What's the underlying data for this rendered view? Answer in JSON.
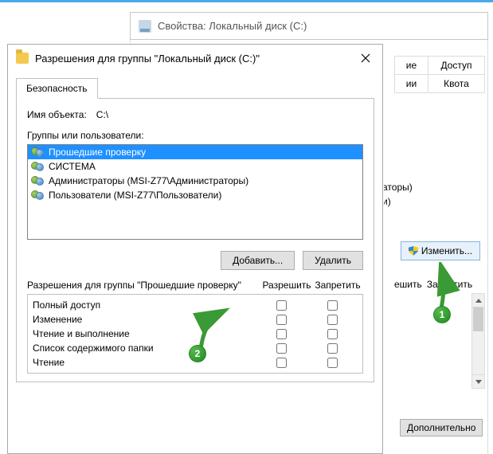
{
  "bg_window": {
    "title": "Свойства: Локальный диск (C:)",
    "tab_right_1a": "ие",
    "tab_right_1b": "Доступ",
    "tab_right_2a": "ии",
    "tab_right_2b": "Квота",
    "group_stub": "аторы)",
    "group_stub2": "и)",
    "edit_btn": "Изменить...",
    "col_allow": "ешить",
    "col_deny": "Запретить",
    "extra_btn": "Дополнительно"
  },
  "dialog": {
    "title": "Разрешения для группы \"Локальный диск (C:)\"",
    "tab": "Безопасность",
    "object_label": "Имя объекта:",
    "object_value": "C:\\",
    "groups_label": "Группы или пользователи:",
    "users": [
      "Прошедшие проверку",
      "СИСТЕМА",
      "Администраторы (MSI-Z77\\Администраторы)",
      "Пользователи (MSI-Z77\\Пользователи)"
    ],
    "add_btn": "Добавить...",
    "remove_btn": "Удалить",
    "perm_for": "Разрешения для группы \"Прошедшие проверку\"",
    "col_allow": "Разрешить",
    "col_deny": "Запретить",
    "perms": [
      "Полный доступ",
      "Изменение",
      "Чтение и выполнение",
      "Список содержимого папки",
      "Чтение"
    ]
  },
  "annot": {
    "num1": "1",
    "num2": "2"
  }
}
